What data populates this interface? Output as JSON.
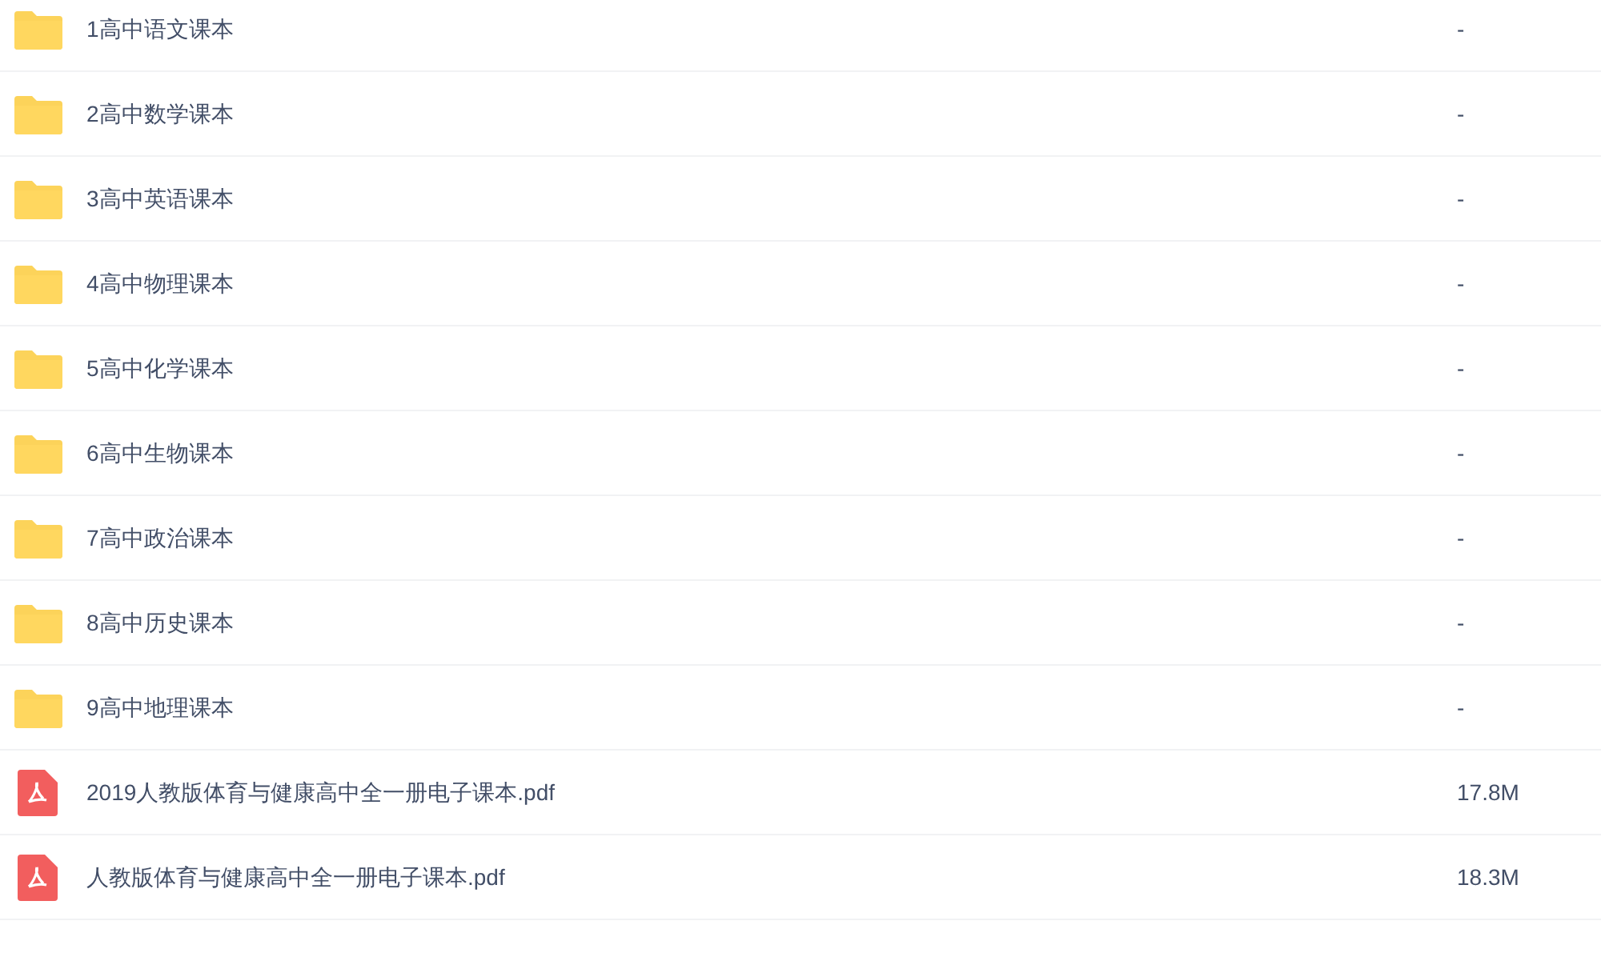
{
  "files": [
    {
      "kind": "folder",
      "name": "1高中语文课本",
      "size": "-"
    },
    {
      "kind": "folder",
      "name": "2高中数学课本",
      "size": "-"
    },
    {
      "kind": "folder",
      "name": "3高中英语课本",
      "size": "-"
    },
    {
      "kind": "folder",
      "name": "4高中物理课本",
      "size": "-"
    },
    {
      "kind": "folder",
      "name": "5高中化学课本",
      "size": "-"
    },
    {
      "kind": "folder",
      "name": "6高中生物课本",
      "size": "-"
    },
    {
      "kind": "folder",
      "name": "7高中政治课本",
      "size": "-"
    },
    {
      "kind": "folder",
      "name": "8高中历史课本",
      "size": "-"
    },
    {
      "kind": "folder",
      "name": "9高中地理课本",
      "size": "-"
    },
    {
      "kind": "pdf",
      "name": "2019人教版体育与健康高中全一册电子课本.pdf",
      "size": "17.8M"
    },
    {
      "kind": "pdf",
      "name": "人教版体育与健康高中全一册电子课本.pdf",
      "size": "18.3M"
    }
  ]
}
